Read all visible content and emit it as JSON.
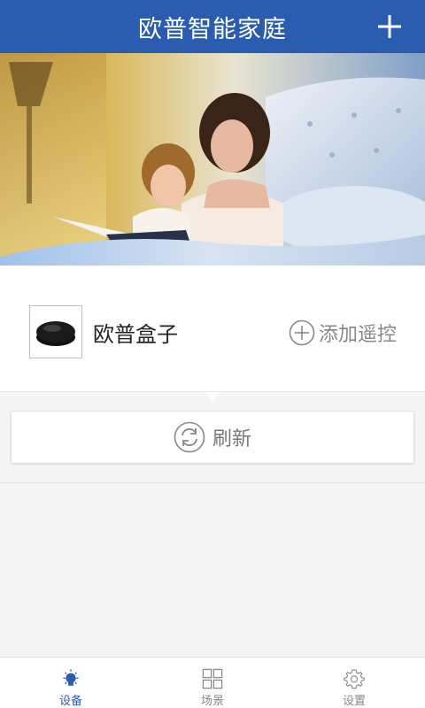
{
  "header": {
    "title": "欧普智能家庭",
    "add_icon": "plus-icon"
  },
  "banner": {
    "icon": "family-reading-photo"
  },
  "device": {
    "name": "欧普盒子",
    "thumb_icon": "ir-box-icon",
    "add_remote_label": "添加遥控",
    "add_remote_icon": "circle-plus-icon"
  },
  "refresh": {
    "label": "刷新",
    "icon": "refresh-icon"
  },
  "tabs": [
    {
      "label": "设备",
      "icon": "bulb-icon",
      "active": true
    },
    {
      "label": "场景",
      "icon": "grid-icon",
      "active": false
    },
    {
      "label": "设置",
      "icon": "gear-icon",
      "active": false
    }
  ],
  "colors": {
    "primary": "#2a5db0",
    "text_gray": "#888888",
    "background": "#f5f5f5"
  }
}
